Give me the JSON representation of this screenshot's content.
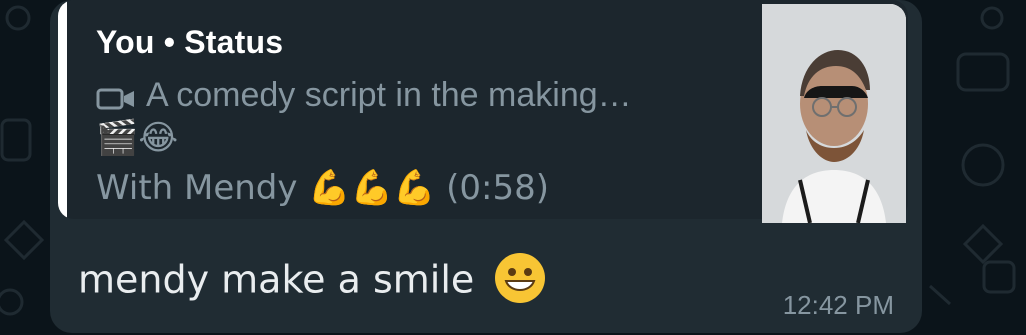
{
  "quote": {
    "author": "You • Status",
    "line1": "A comedy script in the making…",
    "line2_emojis": "🎬😂",
    "line3_text": "With Mendy 💪💪💪 (0:58)"
  },
  "message": {
    "text": "mendy make a smile",
    "emoji": "😀",
    "time": "12:42 PM"
  },
  "icons": {
    "video": "video-camera-icon",
    "thumbnail": "video-thumbnail"
  },
  "colors": {
    "background": "#0b141a",
    "bubble": "#202c33",
    "quote_bg": "#1c262d",
    "quote_bar": "#ffffff",
    "muted_text": "#8696a0",
    "text": "#e9edef"
  }
}
